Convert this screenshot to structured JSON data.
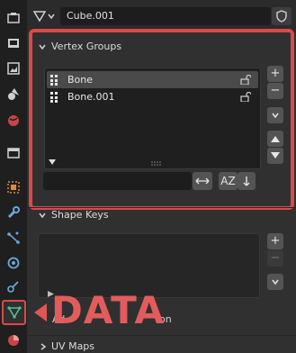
{
  "header": {
    "object_name": "Cube.001",
    "mesh_type_icon": "mesh-triangle-icon",
    "fake_user_icon": "shield-icon"
  },
  "sidebar": {
    "tabs": [
      {
        "name": "tool-tab",
        "icon": "tool-icon"
      },
      {
        "name": "render-tab",
        "icon": "camera-back-icon"
      },
      {
        "name": "output-tab",
        "icon": "printer-icon"
      },
      {
        "name": "view-layer-tab",
        "icon": "image-stack-icon"
      },
      {
        "name": "scene-tab",
        "icon": "scene-icon"
      },
      {
        "name": "world-tab",
        "icon": "globe-icon"
      },
      {
        "name": "collection-tab",
        "icon": "box-icon"
      },
      {
        "name": "object-tab",
        "icon": "orange-square-icon"
      },
      {
        "name": "modifier-tab",
        "icon": "wrench-icon"
      },
      {
        "name": "particles-tab",
        "icon": "particles-icon"
      },
      {
        "name": "physics-tab",
        "icon": "orbit-icon"
      },
      {
        "name": "constraints-tab",
        "icon": "constraint-icon"
      },
      {
        "name": "data-tab",
        "icon": "mesh-triangle-icon",
        "active": true
      },
      {
        "name": "material-tab",
        "icon": "material-sphere-icon"
      }
    ]
  },
  "vertex_groups": {
    "title": "Vertex Groups",
    "items": [
      {
        "label": "Bone",
        "selected": true
      },
      {
        "label": "Bone.001",
        "selected": false
      }
    ],
    "buttons": {
      "add": "+",
      "remove": "−"
    },
    "sort_label": "AZ"
  },
  "shape_keys": {
    "title": "Shape Keys",
    "buttons": {
      "add": "+",
      "remove": "−"
    }
  },
  "partially_visible": {
    "auto_smooth_fragment": "Ad",
    "auto_smooth_tail": "on"
  },
  "uv_maps": {
    "title": "UV Maps"
  },
  "annotation": {
    "label": "DATA",
    "color": "#e35c5c"
  },
  "colors": {
    "highlight": "#d94a4a",
    "panel_bg": "#303030",
    "sidebar_bg": "#1f1f1f"
  }
}
